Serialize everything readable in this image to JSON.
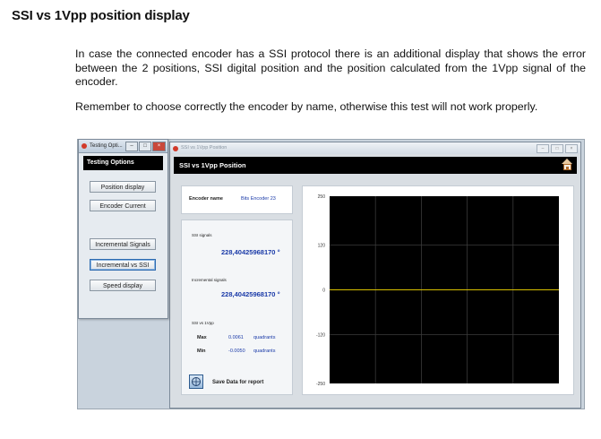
{
  "doc": {
    "heading": "SSI vs 1Vpp position display",
    "para1": "In case the connected encoder has a SSI protocol there is an additional display that shows the error between the 2 positions, SSI digital position and the position calculated from the 1Vpp signal of the encoder.",
    "para2": "Remember to choose correctly the encoder by name, otherwise this test will not work properly."
  },
  "left_window": {
    "title": "Testing Opti...",
    "header": "Testing Options",
    "buttons": [
      "Position display",
      "Encoder Current",
      "Incremental Signals",
      "Incremental vs SSI",
      "Speed display"
    ],
    "selected": "Incremental vs SSI"
  },
  "main_window": {
    "title": "SSI vs 1Vpp Position",
    "header": "SSI vs 1Vpp Position",
    "encoder_label": "Encoder name",
    "encoder_value": "Bits Encoder 23",
    "ssi_label": "SSI signals",
    "ssi_value": "228,40425968170 °",
    "inc_label": "Incremental signals",
    "inc_value": "228,40425968170 °",
    "diff_label": "SSI vs 1Vpp",
    "max_label": "Max",
    "max_value": "0.0061",
    "max_unit": "quadrants",
    "min_label": "Min",
    "min_value": "-0.0050",
    "min_unit": "quadrants",
    "save_label": "Save Data for report",
    "colors": {
      "plot_bg": "#000000",
      "grid": "#3a3a3a",
      "trace": "#d8c000"
    }
  },
  "chart_data": {
    "type": "line",
    "title": "",
    "xlabel": "",
    "ylabel": "",
    "ylim": [
      -250,
      250
    ],
    "yticks": [
      250,
      120,
      0,
      -120,
      -250
    ],
    "ytick_labels": [
      "250",
      "120",
      "0",
      "-120",
      "-250"
    ],
    "x_divisions": 5,
    "grid": true,
    "series": [
      {
        "x": [
          0,
          1
        ],
        "y": [
          0,
          0
        ]
      }
    ]
  }
}
